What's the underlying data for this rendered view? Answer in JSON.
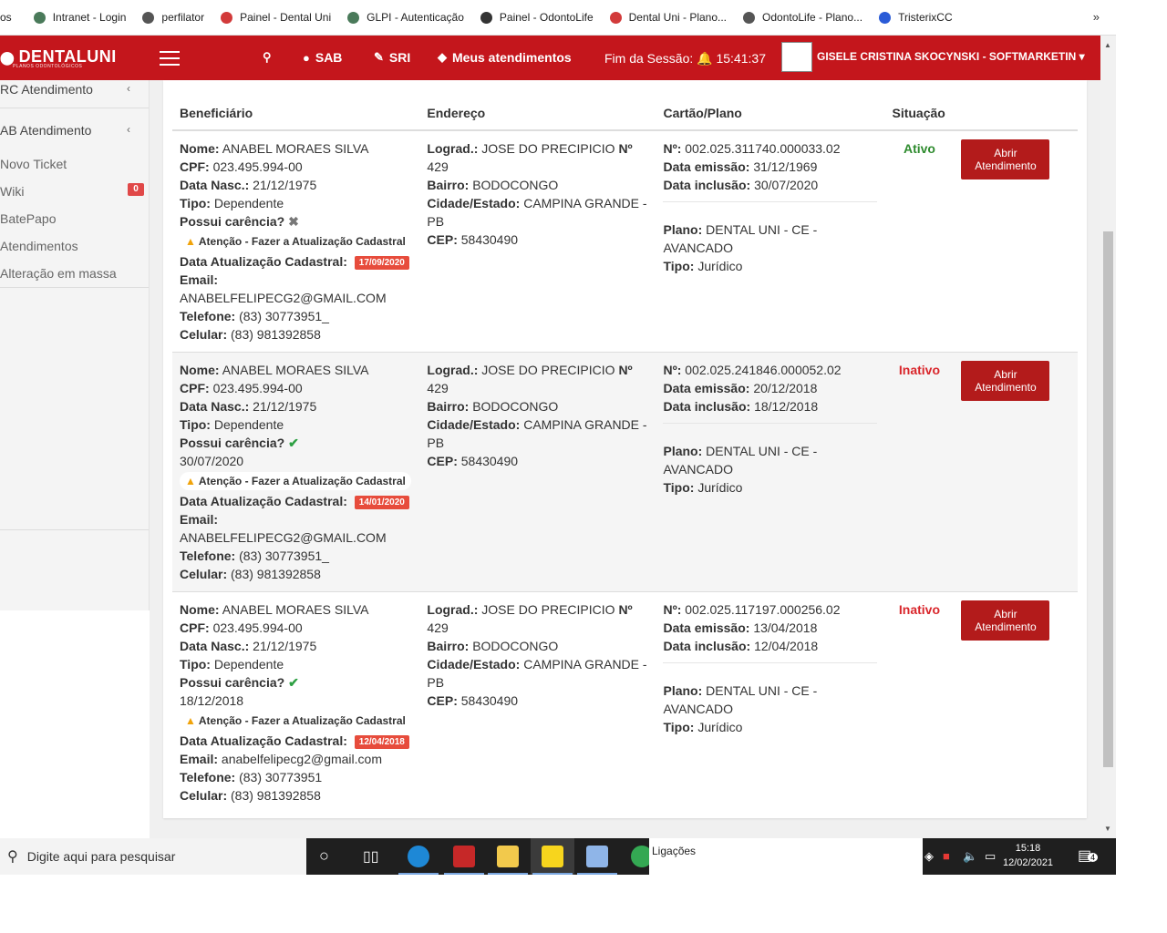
{
  "bookmarks": {
    "items": [
      {
        "label": "os",
        "color": ""
      },
      {
        "label": "Intranet - Login",
        "color": "#4a7a5a"
      },
      {
        "label": "perfilator",
        "color": "#555"
      },
      {
        "label": "Painel - Dental Uni",
        "color": "#d23a3a"
      },
      {
        "label": "GLPI - Autenticação",
        "color": "#4a7a5a"
      },
      {
        "label": "Painel - OdontoLife",
        "color": "#333"
      },
      {
        "label": "Dental Uni - Plano...",
        "color": "#d23a3a"
      },
      {
        "label": "OdontoLife - Plano...",
        "color": "#555"
      },
      {
        "label": "TristerixCC",
        "color": "#2a5bd7"
      }
    ],
    "more": "»"
  },
  "header": {
    "logo": "DENTALUNI",
    "logo_sub": "PLANOS ODONTOLÓGICOS",
    "nav": [
      {
        "icon": "search-icon",
        "glyph": "🔍",
        "label": ""
      },
      {
        "icon": "comment-icon",
        "glyph": "💬",
        "label": "SAB"
      },
      {
        "icon": "wrench-icon",
        "glyph": "🔧",
        "label": "SRI"
      },
      {
        "icon": "tag-icon",
        "glyph": "◆",
        "label": "Meus atendimentos"
      }
    ],
    "session_label": "Fim da Sessão:",
    "session_time": "15:41:37",
    "user": "GISELE CRISTINA SKOCYNSKI - SOFTMARKETIN",
    "user_caret": "▾"
  },
  "sidebar": {
    "sections": [
      {
        "label": "RC Atendimento",
        "chevron": "‹"
      },
      {
        "label": "AB Atendimento",
        "chevron": "‹"
      }
    ],
    "items": [
      {
        "label": "Novo Ticket"
      },
      {
        "label": "Wiki",
        "badge": "0"
      },
      {
        "label": "BatePapo"
      },
      {
        "label": "Atendimentos"
      },
      {
        "label": "Alteração em massa"
      }
    ]
  },
  "table": {
    "headers": [
      "Beneficiário",
      "Endereço",
      "Cartão/Plano",
      "Situação"
    ],
    "labels": {
      "nome": "Nome:",
      "cpf": "CPF:",
      "nasc": "Data Nasc.:",
      "tipo": "Tipo:",
      "carencia": "Possui carência?",
      "warn": "Atenção - Fazer a Atualização Cadastral",
      "data_atual": "Data Atualização Cadastral:",
      "email": "Email:",
      "telefone": "Telefone:",
      "celular": "Celular:",
      "lograd": "Lograd.:",
      "bairro": "Bairro:",
      "cidade": "Cidade/Estado:",
      "cep": "CEP:",
      "numero": "Nº:",
      "emissao": "Data emissão:",
      "inclusao": "Data inclusão:",
      "plano": "Plano:",
      "plano_tipo": "Tipo:",
      "button": "Abrir Atendimento"
    },
    "rows": [
      {
        "nome": "ANABEL MORAES SILVA",
        "cpf": "023.495.994-00",
        "nasc": "21/12/1975",
        "tipo": "Dependente",
        "carencia_icon": "✖",
        "carencia_date": "",
        "data_atual": "17/09/2020",
        "email": "ANABELFELIPECG2@GMAIL.COM",
        "telefone": "(83) 30773951_",
        "celular": "(83) 981392858",
        "lograd": "JOSE DO PRECIPICIO",
        "lograd_num_label": "Nº",
        "lograd_num": "429",
        "bairro": "BODOCONGO",
        "cidade": "CAMPINA GRANDE - PB",
        "cep": "58430490",
        "numero": "002.025.311740.000033.02",
        "emissao": "31/12/1969",
        "inclusao": "30/07/2020",
        "plano": "DENTAL UNI - CE - AVANCADO",
        "plano_tipo": "Jurídico",
        "situacao": "Ativo"
      },
      {
        "nome": "ANABEL MORAES SILVA",
        "cpf": "023.495.994-00",
        "nasc": "21/12/1975",
        "tipo": "Dependente",
        "carencia_icon": "✔",
        "carencia_date": "30/07/2020",
        "data_atual": "14/01/2020",
        "email": "ANABELFELIPECG2@GMAIL.COM",
        "telefone": "(83) 30773951_",
        "celular": "(83) 981392858",
        "lograd": "JOSE DO PRECIPICIO",
        "lograd_num_label": "Nº",
        "lograd_num": "429",
        "bairro": "BODOCONGO",
        "cidade": "CAMPINA GRANDE - PB",
        "cep": "58430490",
        "numero": "002.025.241846.000052.02",
        "emissao": "20/12/2018",
        "inclusao": "18/12/2018",
        "plano": "DENTAL UNI - CE - AVANCADO",
        "plano_tipo": "Jurídico",
        "situacao": "Inativo"
      },
      {
        "nome": "ANABEL MORAES SILVA",
        "cpf": "023.495.994-00",
        "nasc": "21/12/1975",
        "tipo": "Dependente",
        "carencia_icon": "✔",
        "carencia_date": "18/12/2018",
        "data_atual": "12/04/2018",
        "email": "anabelfelipecg2@gmail.com",
        "telefone": "(83) 30773951",
        "celular": "(83) 981392858",
        "lograd": "JOSE DO PRECIPICIO",
        "lograd_num_label": "Nº",
        "lograd_num": "429",
        "bairro": "BODOCONGO",
        "cidade": "CAMPINA GRANDE - PB",
        "cep": "58430490",
        "numero": "002.025.117197.000256.02",
        "emissao": "13/04/2018",
        "inclusao": "12/04/2018",
        "plano": "DENTAL UNI - CE - AVANCADO",
        "plano_tipo": "Jurídico",
        "situacao": "Inativo"
      }
    ]
  },
  "taskbar": {
    "search_placeholder": "Digite aqui para pesquisar",
    "ligacoes": "Ligações",
    "time": "15:18",
    "date": "12/02/2021",
    "notif_count": "4"
  },
  "colors": {
    "brand_red": "#c4161c",
    "button_red": "#b31b1b",
    "active_green": "#2e8b2e",
    "inactive_red": "#d9262b"
  }
}
